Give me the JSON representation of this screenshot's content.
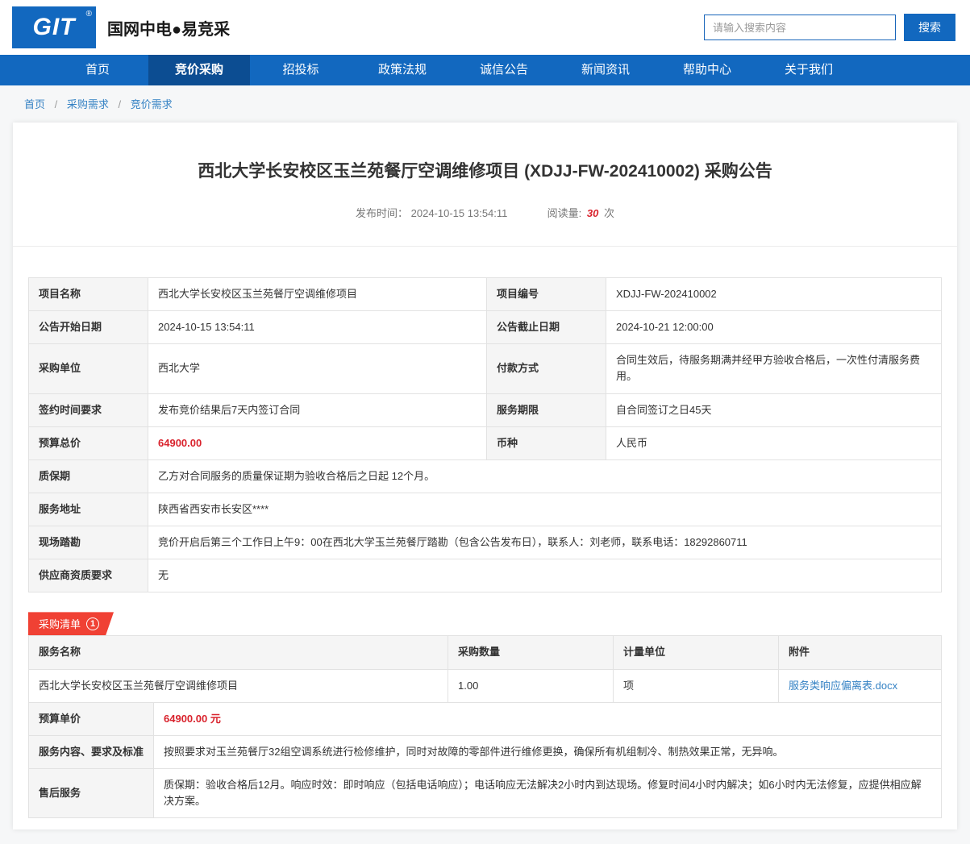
{
  "colors": {
    "primary": "#1268bf",
    "primary-dark": "#0c4d92",
    "accent-red": "#f04134",
    "price-red": "#d9232d",
    "link-blue": "#3582c4"
  },
  "header": {
    "logo": "GIT",
    "logo_reg": "®",
    "title": "国网中电●易竞采",
    "search": {
      "placeholder": "请输入搜索内容",
      "button": "搜索"
    }
  },
  "nav": {
    "items": [
      "首页",
      "竞价采购",
      "招投标",
      "政策法规",
      "诚信公告",
      "新闻资讯",
      "帮助中心",
      "关于我们"
    ]
  },
  "breadcrumb": {
    "items": [
      "首页",
      "采购需求",
      "竞价需求"
    ],
    "separator": "/"
  },
  "announcement": {
    "title": "西北大学长安校区玉兰苑餐厅空调维修项目 (XDJJ-FW-202410002) 采购公告",
    "publish_label": "发布时间：",
    "publish_time": "2024-10-15 13:54:11",
    "views_label": "阅读量:",
    "views_count": "30",
    "views_unit": "次"
  },
  "info": {
    "pairs": [
      {
        "l1": "项目名称",
        "v1": "西北大学长安校区玉兰苑餐厅空调维修项目",
        "l2": "项目编号",
        "v2": "XDJJ-FW-202410002"
      },
      {
        "l1": "公告开始日期",
        "v1": "2024-10-15 13:54:11",
        "l2": "公告截止日期",
        "v2": "2024-10-21 12:00:00"
      },
      {
        "l1": "采购单位",
        "v1": "西北大学",
        "l2": "付款方式",
        "v2": "合同生效后，待服务期满并经甲方验收合格后，一次性付清服务费用。"
      },
      {
        "l1": "签约时间要求",
        "v1": "发布竞价结果后7天内签订合同",
        "l2": "服务期限",
        "v2": "自合同签订之日45天"
      },
      {
        "l1": "预算总价",
        "v1": "64900.00",
        "l2": "币种",
        "v2": "人民币"
      }
    ],
    "full": [
      {
        "label": "质保期",
        "value": "乙方对合同服务的质量保证期为验收合格后之日起 12个月。"
      },
      {
        "label": "服务地址",
        "value": "陕西省西安市长安区****"
      },
      {
        "label": "现场踏勘",
        "value": "竞价开启后第三个工作日上午9：00在西北大学玉兰苑餐厅踏勘（包含公告发布日），联系人：刘老师，联系电话：18292860711"
      },
      {
        "label": "供应商资质要求",
        "value": "无"
      }
    ]
  },
  "listing": {
    "tab_label": "采购清单",
    "tab_badge": "1",
    "headers": [
      "服务名称",
      "采购数量",
      "计量单位",
      "附件"
    ],
    "row": {
      "name": "西北大学长安校区玉兰苑餐厅空调维修项目",
      "qty": "1.00",
      "unit": "项",
      "attachment": "服务类响应偏离表.docx"
    },
    "details": [
      {
        "label": "预算单价",
        "value": "64900.00 元"
      },
      {
        "label": "服务内容、要求及标准",
        "value": "按照要求对玉兰苑餐厅32组空调系统进行检修维护，同时对故障的零部件进行维修更换，确保所有机组制冷、制热效果正常，无异响。"
      },
      {
        "label": "售后服务",
        "value": "质保期：验收合格后12月。响应时效：即时响应（包括电话响应）；电话响应无法解决2小时内到达现场。修复时间4小时内解决；如6小时内无法修复，应提供相应解决方案。"
      }
    ]
  }
}
